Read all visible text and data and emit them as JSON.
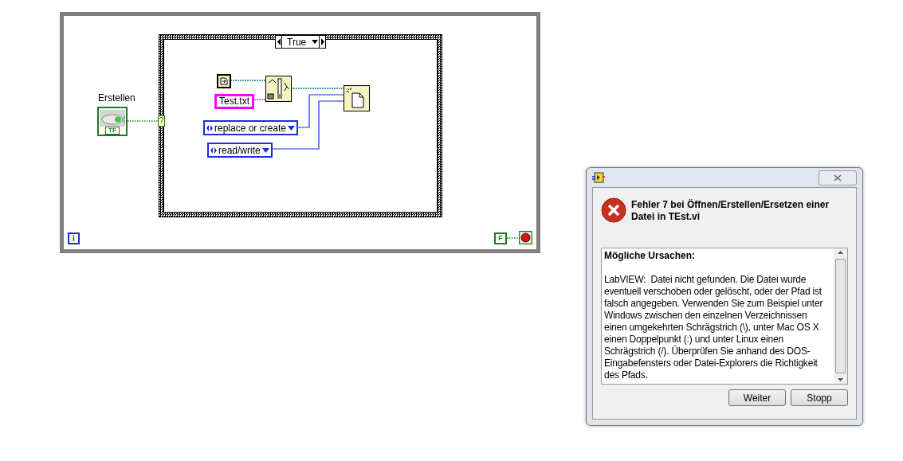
{
  "diagram": {
    "while_loop": {
      "iteration_terminal": "i",
      "stop_constant": "F"
    },
    "control": {
      "label": "Erstellen",
      "badge": "TF"
    },
    "case_structure": {
      "selector_terminal": "?",
      "case": "True"
    },
    "path_constant": "Test.txt",
    "enums": [
      {
        "value": "replace or create"
      },
      {
        "value": "read/write"
      }
    ]
  },
  "dialog": {
    "heading": "Fehler 7 bei Öffnen/Erstellen/Ersetzen einer Datei in TEst.vi",
    "causes_title": "Mögliche Ursachen:",
    "message": "LabVIEW:  Datei nicht gefunden. Die Datei wurde eventuell verschoben oder gelöscht, oder der Pfad ist falsch angegeben. Verwenden Sie zum Beispiel unter Windows zwischen den einzelnen Verzeichnissen einen umgekehrten Schrägstrich (\\), unter Mac OS X einen Doppelpunkt (:) und unter Linux einen Schrägstrich (/). Überprüfen Sie anhand des DOS-Eingabefensters oder Datei-Explorers die Richtigkeit des Pfads.",
    "buttons": [
      "Weiter",
      "Stopp"
    ]
  }
}
